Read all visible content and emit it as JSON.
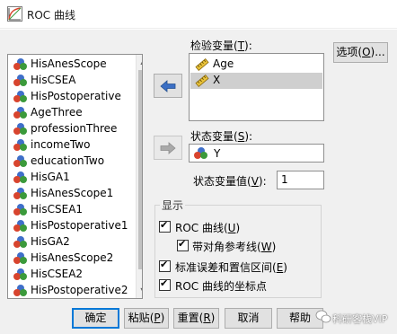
{
  "window": {
    "title": "ROC 曲线"
  },
  "source_list": {
    "items": [
      "HisAnesScope",
      "HisCSEA",
      "HisPostoperative",
      "AgeThree",
      "professionThree",
      "incomeTwo",
      "educationTwo",
      "HisGA1",
      "HisAnesScope1",
      "HisCSEA1",
      "HisPostoperative1",
      "HisGA2",
      "HisAnesScope2",
      "HisCSEA2",
      "HisPostoperative2"
    ]
  },
  "test_variable": {
    "label": "检验变量",
    "hotkey": "T",
    "items": [
      "Age",
      "X"
    ],
    "selected": "X"
  },
  "state_variable": {
    "label": "状态变量",
    "hotkey": "S",
    "value": "Y"
  },
  "state_value": {
    "label": "状态变量值",
    "hotkey": "V",
    "value": "1"
  },
  "display": {
    "legend": "显示",
    "roc_curve": {
      "label": "ROC 曲线",
      "hotkey": "U",
      "checked": true
    },
    "diagonal": {
      "label": "带对角参考线",
      "hotkey": "W",
      "checked": true
    },
    "stderr": {
      "label": "标准误差和置信区间",
      "hotkey": "E",
      "checked": true
    },
    "coords": {
      "label": "ROC 曲线的坐标点",
      "hotkey": "",
      "checked": true
    }
  },
  "options_button": {
    "label": "选项",
    "hotkey": "O"
  },
  "buttons": {
    "ok": "确定",
    "paste": "粘贴",
    "paste_hotkey": "P",
    "reset": "重置",
    "reset_hotkey": "R",
    "cancel": "取消",
    "help": "帮助"
  },
  "watermark": "科研客栈VIP",
  "icons": {
    "app": "roc-chart-icon",
    "nominal": "nominal-variable-icon",
    "scale": "scale-variable-icon",
    "move_right": "arrow-right-icon",
    "move_left": "arrow-left-icon"
  },
  "colors": {
    "selection": "#cfcfcf",
    "default_button_border": "#0078d7"
  }
}
